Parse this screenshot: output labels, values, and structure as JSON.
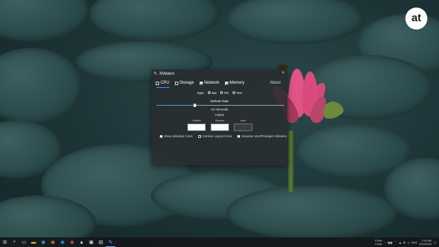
{
  "logo": {
    "text": "at"
  },
  "window": {
    "title": "XMeters",
    "close_glyph": "×",
    "tabs": [
      {
        "label": "CPU",
        "checked": false,
        "active": true
      },
      {
        "label": "Storage",
        "checked": false,
        "active": false
      },
      {
        "label": "Network",
        "checked": true,
        "active": false
      },
      {
        "label": "Memory",
        "checked": true,
        "active": false
      }
    ],
    "about_label": "About",
    "type_label": "Type:",
    "type_options": [
      {
        "label": "Bar",
        "selected": true
      },
      {
        "label": "Pie",
        "selected": false
      },
      {
        "label": "Text",
        "selected": false
      }
    ],
    "refresh_label": "Refresh Rate",
    "refresh_value": "3.0 Seconds",
    "refresh_fraction": 0.3,
    "colors_label": "Colors",
    "swatches": [
      {
        "label": "Outline",
        "color": "#ffffff"
      },
      {
        "label": "System",
        "color": "#ffffff"
      },
      {
        "label": "User",
        "color": "#3c3c3c"
      }
    ],
    "options": [
      {
        "label": "Show Individual Cores",
        "checked": true
      },
      {
        "label": "Combine Logical Cores",
        "checked": false
      },
      {
        "label": "Separate User/Privileged Utilization",
        "checked": true
      }
    ]
  },
  "taskbar": {
    "icons": [
      "windows-icon",
      "search-icon",
      "task-view-icon",
      "file-explorer-icon",
      "chrome-icon",
      "firefox-icon",
      "edge-icon",
      "chrome-icon",
      "steam-icon",
      "terminal-icon",
      "store-icon",
      "xmeters-icon"
    ],
    "tray": {
      "net_up": "0 Kbs",
      "net_down": "2 Kbs",
      "language": "ENG",
      "time": "2:19 AM",
      "date": "6/24/2020"
    }
  },
  "colors": {
    "accent": "#3aa0ff"
  }
}
